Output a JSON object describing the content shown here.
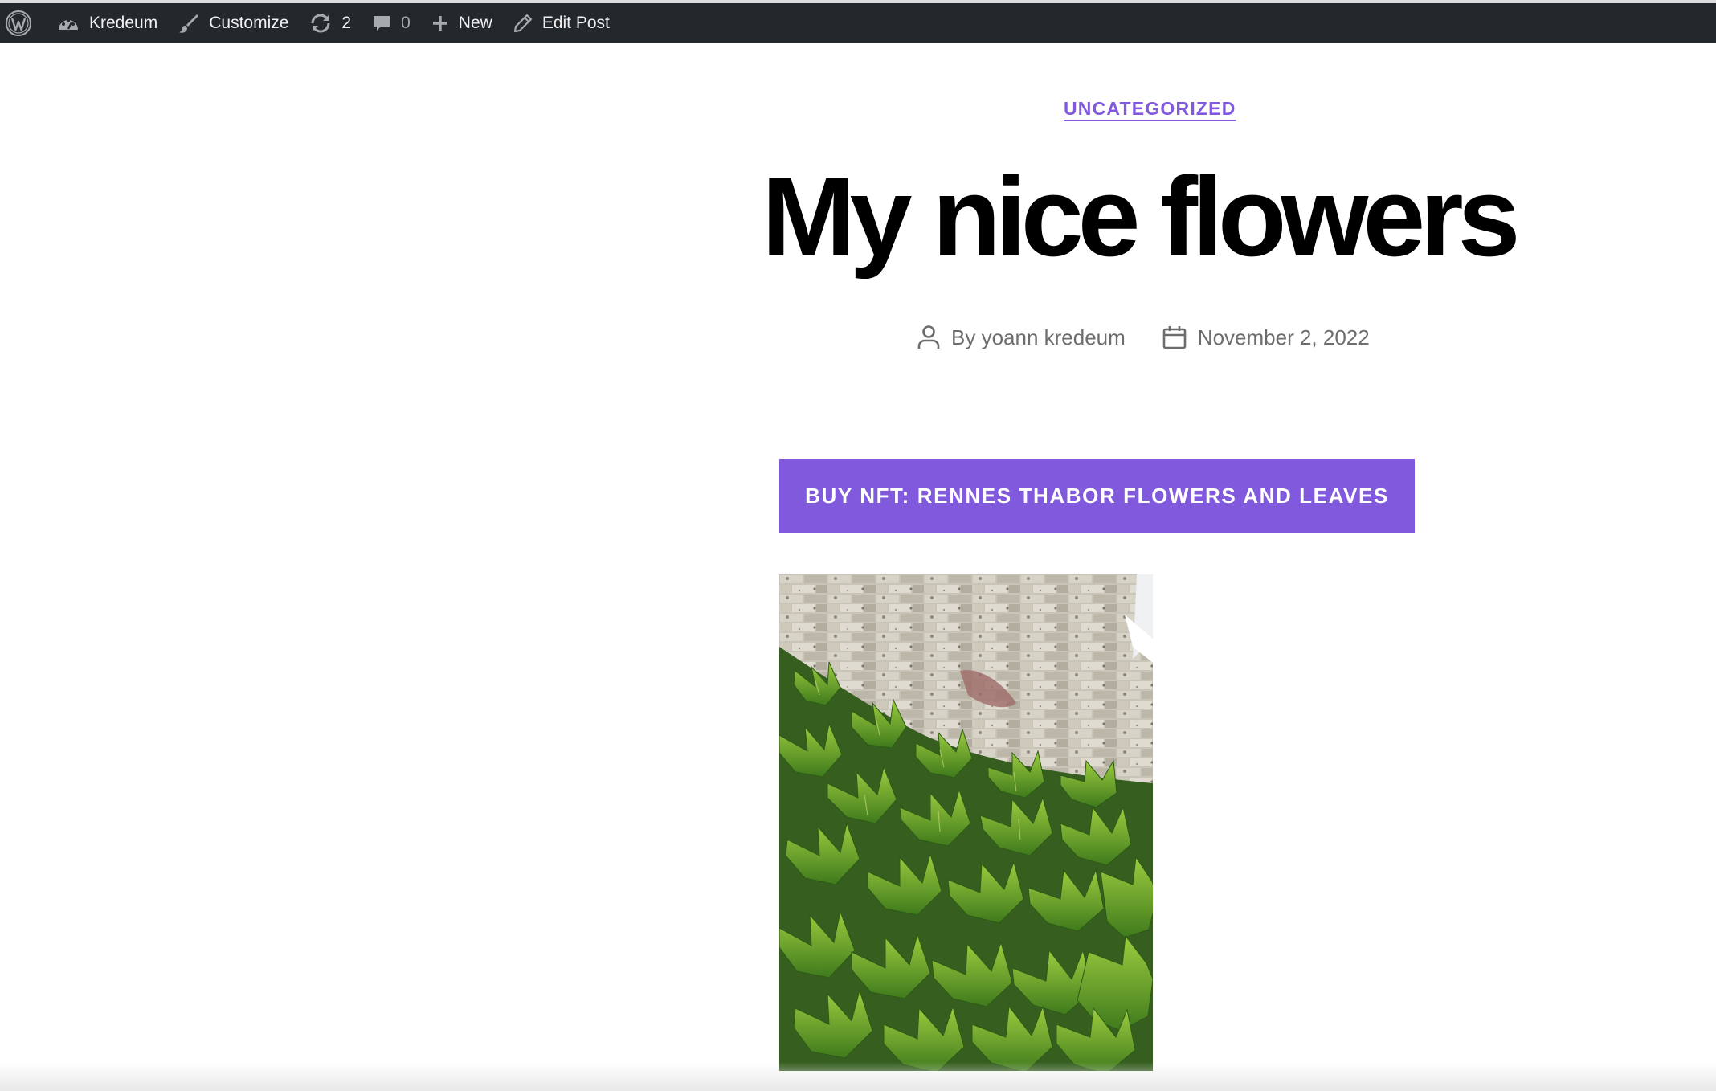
{
  "admin_bar": {
    "wp_logo_icon": "wordpress-logo-icon",
    "site_name": "Kredeum",
    "site_icon": "dashboard-icon",
    "customize_label": "Customize",
    "customize_icon": "brush-icon",
    "updates_count": "2",
    "updates_icon": "update-icon",
    "comments_count": "0",
    "comments_icon": "comment-icon",
    "new_label": "New",
    "new_icon": "plus-icon",
    "edit_label": "Edit Post",
    "edit_icon": "pencil-icon"
  },
  "post": {
    "category": "UNCATEGORIZED",
    "title": "My nice flowers",
    "author_icon": "user-icon",
    "author": "By yoann kredeum",
    "date_icon": "calendar-icon",
    "date": "November 2, 2022",
    "buy_button": "BUY NFT: RENNES THABOR FLOWERS AND LEAVES"
  },
  "colors": {
    "accent": "#8159dc",
    "admin_bar_bg": "#23282d",
    "meta_text": "#6d6d6d"
  }
}
